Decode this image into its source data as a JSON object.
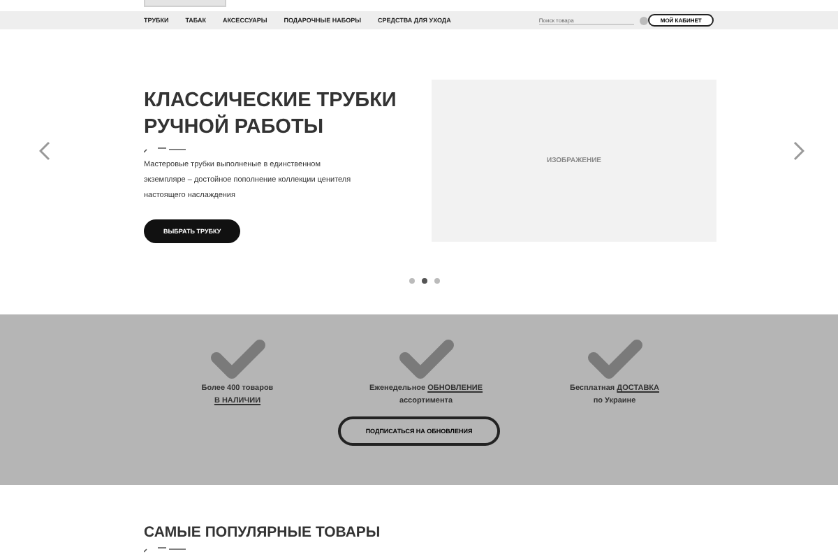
{
  "nav": {
    "items": [
      {
        "label": "ТРУБКИ"
      },
      {
        "label": "ТАБАК"
      },
      {
        "label": "АКСЕССУАРЫ"
      },
      {
        "label": "ПОДАРОЧНЫЕ НАБОРЫ"
      },
      {
        "label": "СРЕДСТВА ДЛЯ УХОДА"
      }
    ],
    "search": {
      "placeholder": "Поиск товара"
    },
    "account_button": "МОЙ КАБИНЕТ"
  },
  "hero": {
    "title": "КЛАССИЧЕСКИЕ ТРУБКИ РУЧНОЙ РАБОТЫ",
    "text": "Мастеровые трубки выполненые в единственном экземпляре – достойное пополнение коллекции ценителя настоящего наслаждения",
    "button": "ВЫБРАТЬ ТРУБКУ",
    "image_label": "ИЗОБРАЖЕНИЕ",
    "dots": [
      {
        "selected": false
      },
      {
        "selected": true
      },
      {
        "selected": false
      }
    ]
  },
  "features": {
    "items": [
      {
        "lines": [
          [
            {
              "text": "Более 400 товаров",
              "underline": false
            }
          ],
          [
            {
              "text": "В НАЛИЧИИ",
              "underline": true
            }
          ]
        ]
      },
      {
        "lines": [
          [
            {
              "text": "Еженедельное ",
              "underline": false
            },
            {
              "text": "ОБНОВЛЕНИЕ",
              "underline": true
            }
          ],
          [
            {
              "text": "ассортимента",
              "underline": false
            }
          ]
        ]
      },
      {
        "lines": [
          [
            {
              "text": "Бесплатная ",
              "underline": false
            },
            {
              "text": "ДОСТАВКА",
              "underline": true
            }
          ],
          [
            {
              "text": "по Украине",
              "underline": false
            }
          ]
        ]
      }
    ],
    "button": "ПОДПИСАТЬСЯ НА ОБНОВЛЕНИЯ"
  },
  "popular": {
    "title": "САМЫЕ ПОПУЛЯРНЫЕ ТОВАРЫ"
  }
}
